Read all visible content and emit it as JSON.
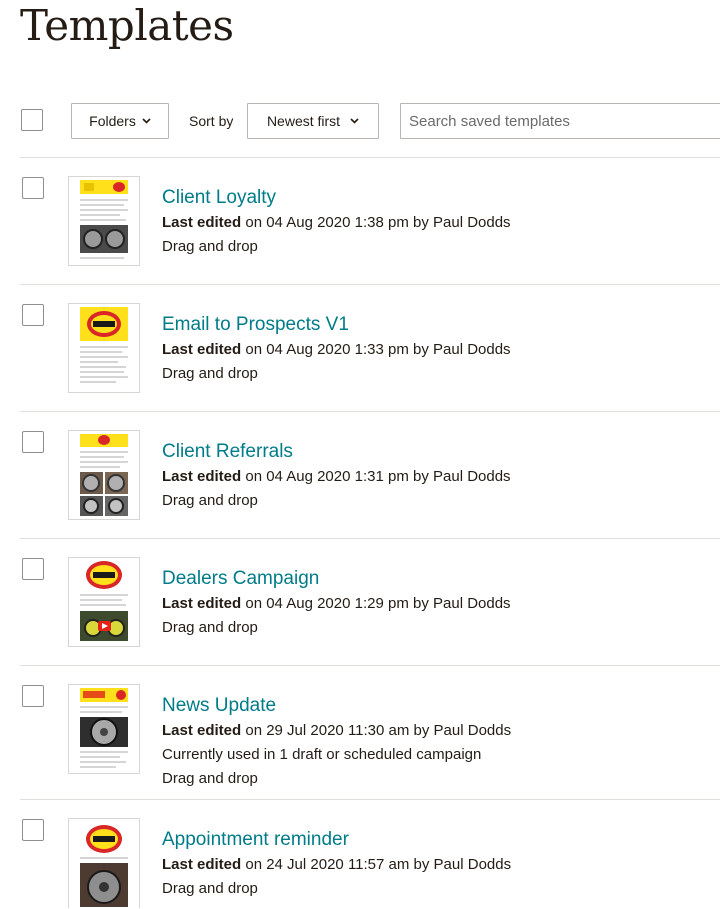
{
  "page": {
    "title": "Templates"
  },
  "toolbar": {
    "folders_label": "Folders",
    "sort_label": "Sort by",
    "sort_value": "Newest first",
    "search_placeholder": "Search saved templates"
  },
  "colors": {
    "link": "#007c89",
    "text": "#241c15",
    "divider": "#e2e0dc",
    "brand_yellow": "#ffe01b"
  },
  "templates": [
    {
      "name": "Client Loyalty",
      "last_edited_label": "Last edited",
      "edited_text": " on 04 Aug 2020 1:38 pm by Paul Dodds",
      "type": "Drag and drop"
    },
    {
      "name": "Email to Prospects V1",
      "last_edited_label": "Last edited",
      "edited_text": " on 04 Aug 2020 1:33 pm by Paul Dodds",
      "type": "Drag and drop"
    },
    {
      "name": "Client Referrals",
      "last_edited_label": "Last edited",
      "edited_text": " on 04 Aug 2020 1:31 pm by Paul Dodds",
      "type": "Drag and drop"
    },
    {
      "name": "Dealers Campaign",
      "last_edited_label": "Last edited",
      "edited_text": " on 04 Aug 2020 1:29 pm by Paul Dodds",
      "type": "Drag and drop"
    },
    {
      "name": "News Update",
      "last_edited_label": "Last edited",
      "edited_text": " on 29 Jul 2020 11:30 am by Paul Dodds",
      "usage": "Currently used in 1 draft or scheduled campaign",
      "type": "Drag and drop"
    },
    {
      "name": "Appointment reminder",
      "last_edited_label": "Last edited",
      "edited_text": " on 24 Jul 2020 11:57 am by Paul Dodds",
      "type": "Drag and drop"
    }
  ]
}
